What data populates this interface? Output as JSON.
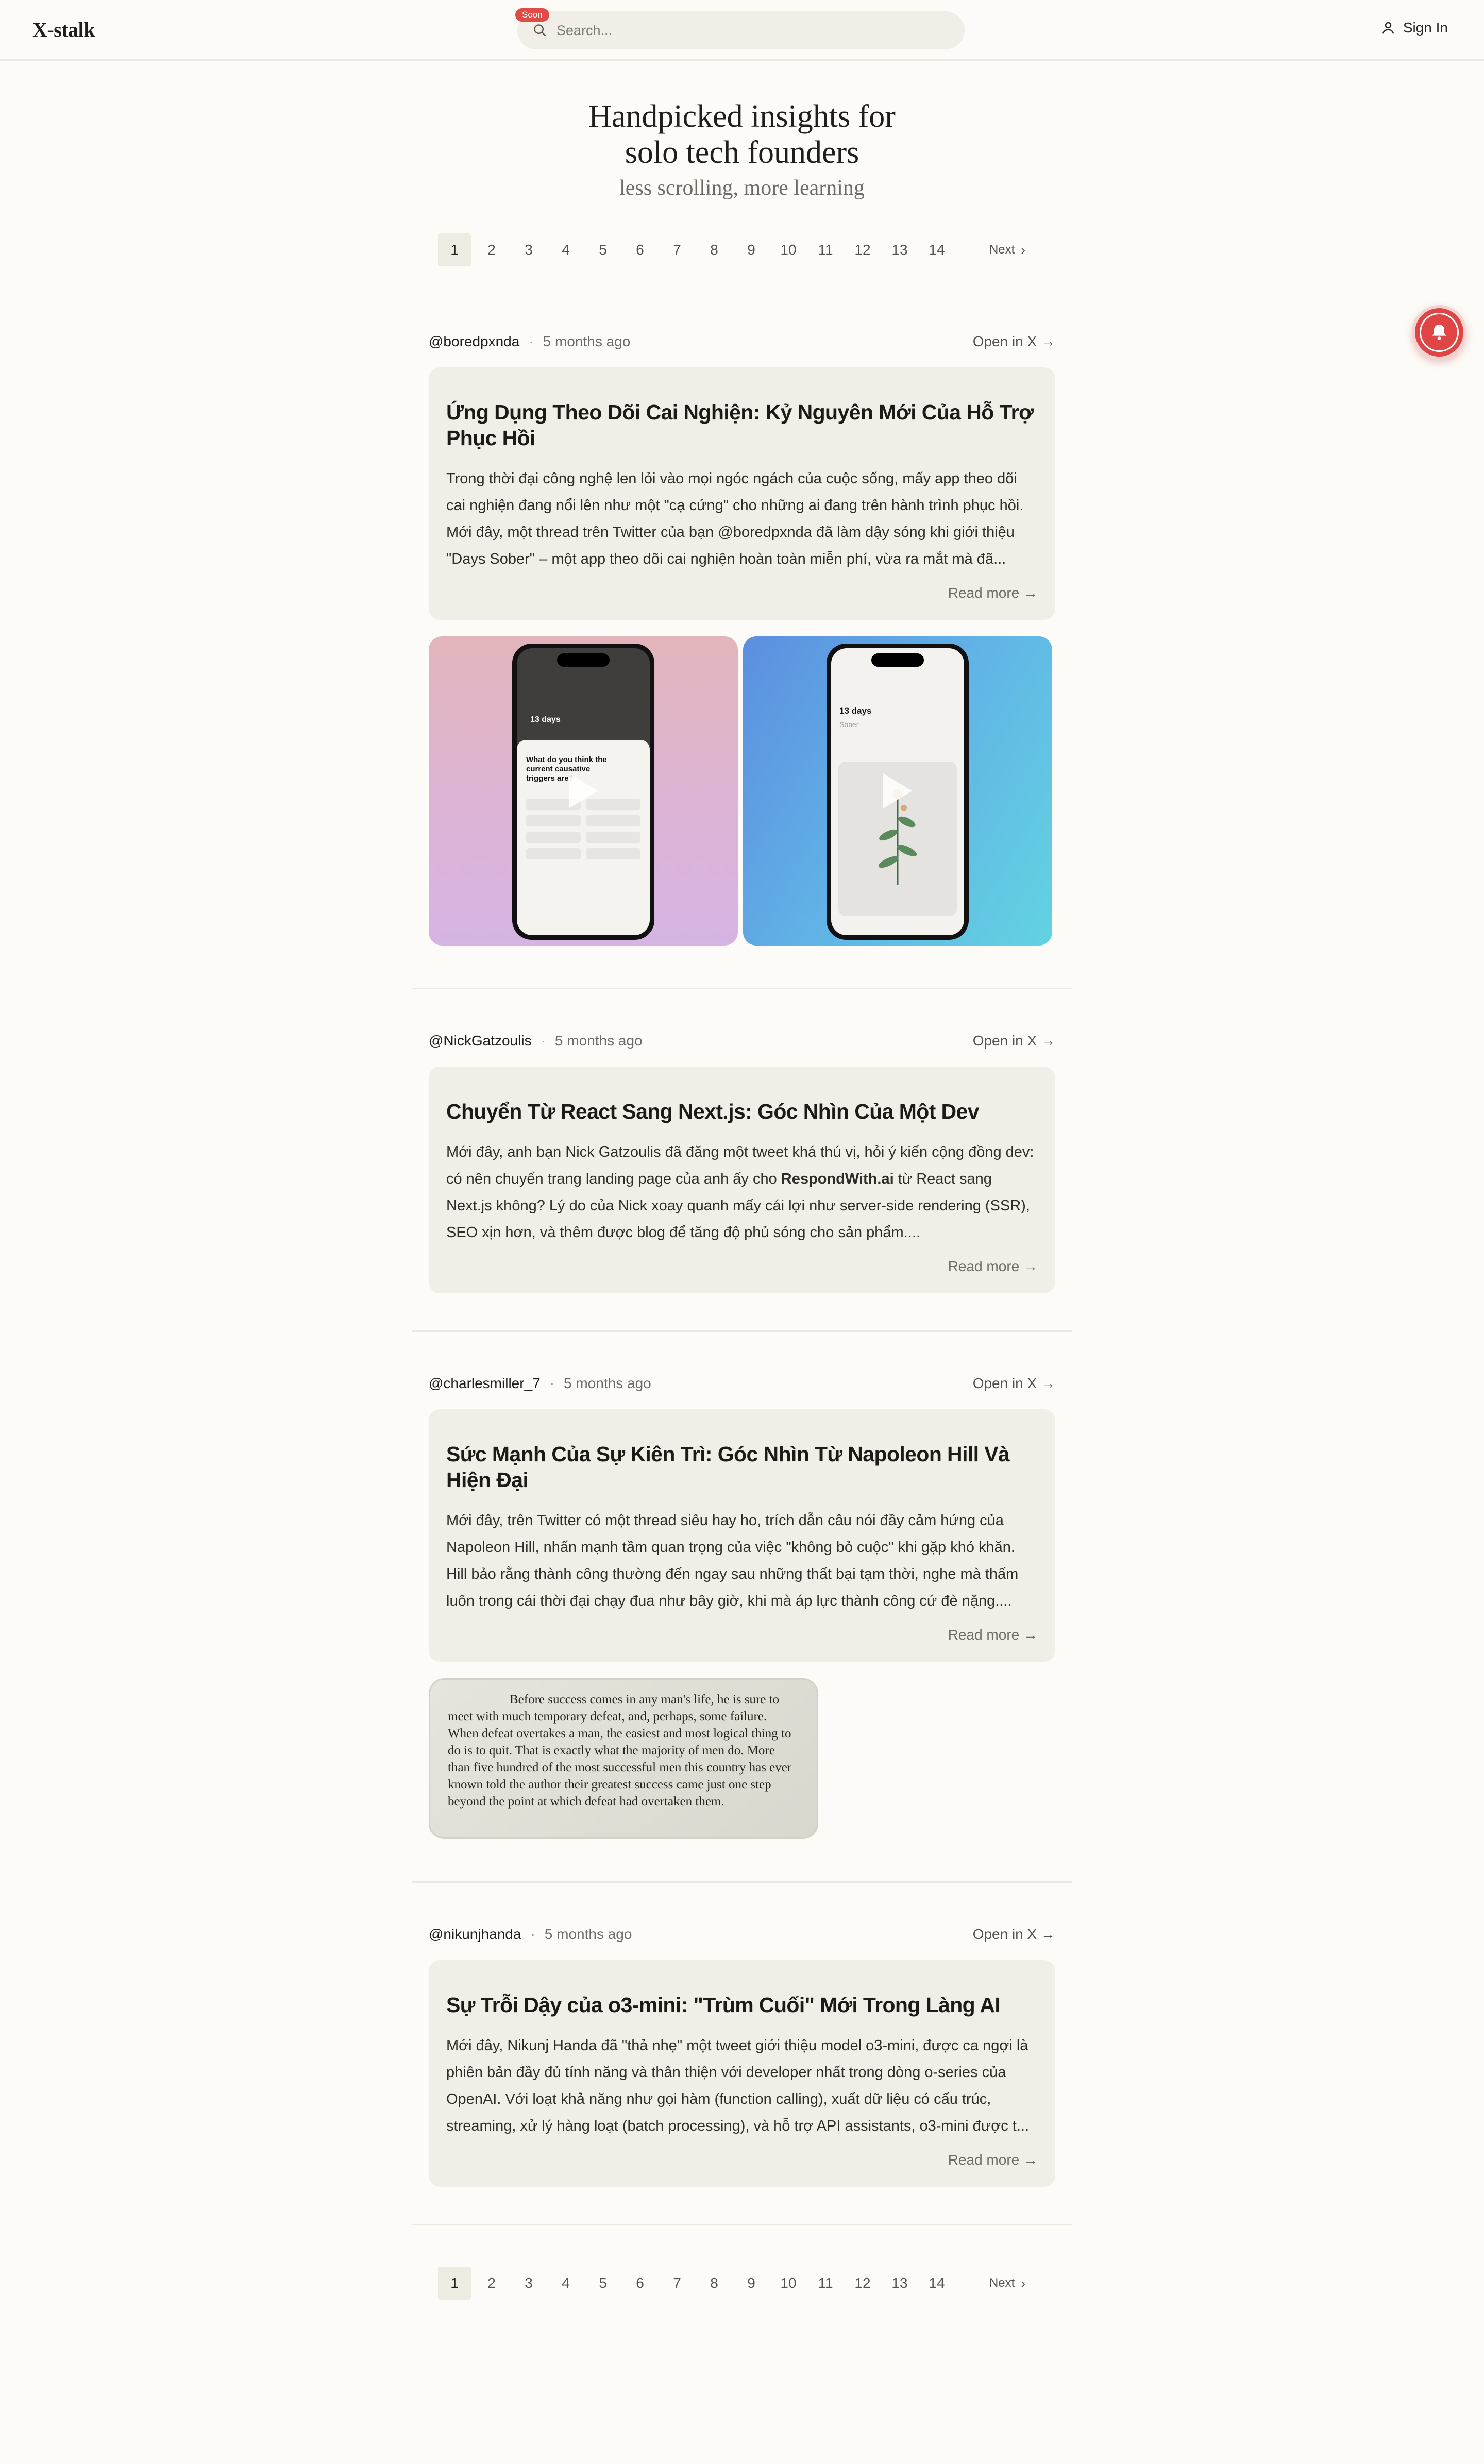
{
  "header": {
    "logo": "X-stalk",
    "search_placeholder": "Search...",
    "soon_badge": "Soon",
    "signin_label": "Sign In"
  },
  "hero": {
    "title_line1": "Handpicked insights for",
    "title_line2": "solo tech founders",
    "subtitle": "less scrolling, more learning"
  },
  "pagination": {
    "pages": [
      "1",
      "2",
      "3",
      "4",
      "5",
      "6",
      "7",
      "8",
      "9",
      "10",
      "11",
      "12",
      "13",
      "14"
    ],
    "active": "1",
    "next_label": "Next",
    "next_arrow": "›"
  },
  "posts": [
    {
      "handle": "@boredpxnda",
      "time": "5 months ago",
      "open_label": "Open in X →",
      "title": "Ứng Dụng Theo Dõi Cai Nghiện: Kỷ Nguyên Mới Của Hỗ Trợ Phục Hồi",
      "excerpt": "Trong thời đại công nghệ len lỏi vào mọi ngóc ngách của cuộc sống, mấy app theo dõi cai nghiện đang nổi lên như một \"cạ cứng\" cho những ai đang trên hành trình phục hồi. Mới đây, một thread trên Twitter của bạn @boredpxnda đã làm dậy sóng khi giới thiệu \"Days Sober\" – một app theo dõi cai nghiện hoàn toàn miễn phí, vừa ra mắt mà đã...",
      "read_more": "Read more →",
      "phone1": {
        "counter": "13 days",
        "question": "What do you think the current causative triggers are?"
      },
      "phone2": {
        "counter": "13 days",
        "status": "Sober"
      }
    },
    {
      "handle": "@NickGatzoulis",
      "time": "5 months ago",
      "open_label": "Open in X →",
      "title": "Chuyển Từ React Sang Next.js: Góc Nhìn Của Một Dev",
      "excerpt_before": "Mới đây, anh bạn Nick Gatzoulis đã đăng một tweet khá thú vị, hỏi ý kiến cộng đồng dev: có nên chuyển trang landing page của anh ấy cho ",
      "excerpt_bold": "RespondWith.ai",
      "excerpt_after": " từ React sang Next.js không? Lý do của Nick xoay quanh mấy cái lợi như server-side rendering (SSR), SEO xịn hơn, và thêm được blog để tăng độ phủ sóng cho sản phẩm....",
      "read_more": "Read more →"
    },
    {
      "handle": "@charlesmiller_7",
      "time": "5 months ago",
      "open_label": "Open in X →",
      "title": "Sức Mạnh Của Sự Kiên Trì: Góc Nhìn Từ Napoleon Hill Và Hiện Đại",
      "excerpt": "Mới đây, trên Twitter có một thread siêu hay ho, trích dẫn câu nói đầy cảm hứng của Napoleon Hill, nhấn mạnh tầm quan trọng của việc \"không bỏ cuộc\" khi gặp khó khăn. Hill bảo rằng thành công thường đến ngay sau những thất bại tạm thời, nghe mà thấm luôn trong cái thời đại chạy đua như bây giờ, khi mà áp lực thành công cứ đè nặng....",
      "read_more": "Read more →",
      "quote_image_text": "Before success comes in any man's life, he is sure to meet with much temporary defeat, and, perhaps, some failure. When defeat overtakes a man, the easiest and most logical thing to do is to quit. That is exactly what the majority of men do. More than five hundred of the most successful men this country has ever known told the author their greatest success came just one step beyond the point at which defeat had overtaken them."
    },
    {
      "handle": "@nikunjhanda",
      "time": "5 months ago",
      "open_label": "Open in X →",
      "title": "Sự Trỗi Dậy của o3-mini: \"Trùm Cuối\" Mới Trong Làng AI",
      "excerpt": "Mới đây, Nikunj Handa đã \"thả nhẹ\" một tweet giới thiệu model o3-mini, được ca ngợi là phiên bản đầy đủ tính năng và thân thiện với developer nhất trong dòng o-series của OpenAI. Với loạt khả năng như gọi hàm (function calling), xuất dữ liệu có cấu trúc, streaming, xử lý hàng loạt (batch processing), và hỗ trợ API assistants, o3-mini được t...",
      "read_more": "Read more →"
    }
  ],
  "colors": {
    "background": "#fcfbf7",
    "card": "#f1eee7",
    "accent_red": "#e04545"
  }
}
